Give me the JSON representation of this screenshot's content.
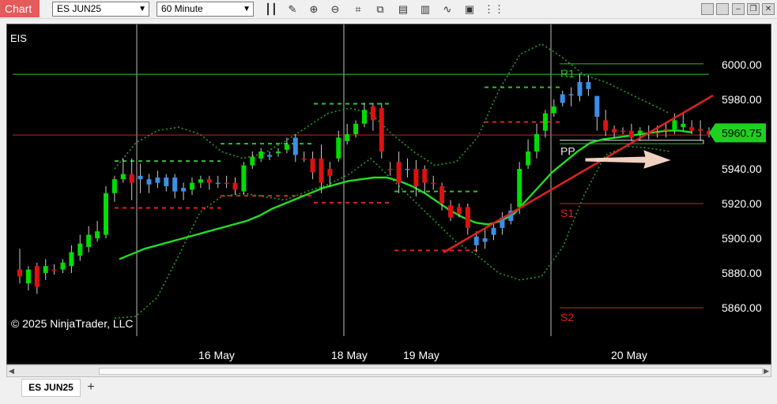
{
  "app": {
    "title": "Chart"
  },
  "toolbar": {
    "instrument": "ES JUN25",
    "interval": "60 Minute",
    "tools": [
      "bars-icon",
      "pencil-icon",
      "zoom-in-icon",
      "zoom-out-icon",
      "crosshair-icon",
      "data-box-icon",
      "instrument-icon",
      "indicators-icon",
      "strategies-icon",
      "properties-icon",
      "grid-icon"
    ]
  },
  "window_controls": [
    "minimize-icon",
    "restore-icon",
    "maximize-icon",
    "close-icon"
  ],
  "chart": {
    "instrument_label": "EIS",
    "copyright": "© 2025 NinjaTrader, LLC",
    "last_price_label": "5960.75",
    "pivot_labels": {
      "r1": "R1",
      "pp": "PP",
      "s1": "S1",
      "s2": "S2"
    },
    "colors": {
      "up": "#00dd00",
      "down": "#dd1111",
      "blue_candle": "#3a8fe8",
      "bollinger": "#2a9a2a",
      "sma": "#22dd22",
      "trendline": "#dd2222",
      "arrow": "#f0d0c0"
    }
  },
  "chart_data": {
    "type": "candlestick",
    "ylim": [
      5840,
      6010
    ],
    "y_ticks": [
      "6000.00",
      "5980.00",
      "5960.00",
      "5940.00",
      "5920.00",
      "5900.00",
      "5880.00",
      "5860.00"
    ],
    "x_labels": [
      "16 May",
      "18 May",
      "19 May",
      "20 May"
    ],
    "last_price": 5960.75,
    "candles": [
      [
        5882,
        5878,
        5894,
        5874,
        "r"
      ],
      [
        5874,
        5882,
        5884,
        5870,
        "g"
      ],
      [
        5884,
        5872,
        5886,
        5868,
        "r"
      ],
      [
        5880,
        5884,
        5888,
        5876,
        "g"
      ],
      [
        5882,
        5882,
        5885,
        5879,
        "r"
      ],
      [
        5882,
        5886,
        5888,
        5880,
        "g"
      ],
      [
        5884,
        5892,
        5896,
        5880,
        "g"
      ],
      [
        5890,
        5897,
        5902,
        5887,
        "g"
      ],
      [
        5895,
        5902,
        5907,
        5892,
        "g"
      ],
      [
        5900,
        5904,
        5910,
        5898,
        "g"
      ],
      [
        5902,
        5926,
        5930,
        5900,
        "g"
      ],
      [
        5926,
        5934,
        5936,
        5921,
        "g"
      ],
      [
        5934,
        5937,
        5946,
        5932,
        "g"
      ],
      [
        5937,
        5932,
        5946,
        5922,
        "r"
      ],
      [
        5936,
        5934,
        5943,
        5926,
        "b"
      ],
      [
        5934,
        5931,
        5937,
        5926,
        "b"
      ],
      [
        5935,
        5932,
        5939,
        5929,
        "b"
      ],
      [
        5935,
        5930,
        5937,
        5927,
        "b"
      ],
      [
        5935,
        5927,
        5937,
        5923,
        "b"
      ],
      [
        5929,
        5927,
        5932,
        5922,
        "b"
      ],
      [
        5928,
        5932,
        5935,
        5925,
        "g"
      ],
      [
        5932,
        5934,
        5936,
        5929,
        "g"
      ],
      [
        5934,
        5932,
        5936,
        5928,
        "r"
      ],
      [
        5932,
        5932,
        5936,
        5929,
        "b"
      ],
      [
        5932,
        5932,
        5936,
        5929,
        "r"
      ],
      [
        5932,
        5928,
        5935,
        5925,
        "r"
      ],
      [
        5927,
        5942,
        5944,
        5925,
        "g"
      ],
      [
        5942,
        5947,
        5950,
        5940,
        "g"
      ],
      [
        5946,
        5950,
        5952,
        5944,
        "g"
      ],
      [
        5947,
        5948,
        5950,
        5945,
        "b"
      ],
      [
        5949,
        5950,
        5952,
        5947,
        "g"
      ],
      [
        5951,
        5954,
        5958,
        5949,
        "g"
      ],
      [
        5958,
        5948,
        5960,
        5944,
        "b"
      ],
      [
        5946,
        5946,
        5950,
        5944,
        "r"
      ],
      [
        5946,
        5938,
        5950,
        5934,
        "r"
      ],
      [
        5946,
        5932,
        5954,
        5926,
        "r"
      ],
      [
        5936,
        5940,
        5944,
        5930,
        "r"
      ],
      [
        5946,
        5958,
        5962,
        5944,
        "g"
      ],
      [
        5956,
        5960,
        5966,
        5954,
        "g"
      ],
      [
        5960,
        5966,
        5968,
        5958,
        "g"
      ],
      [
        5966,
        5974,
        5978,
        5964,
        "g"
      ],
      [
        5976,
        5968,
        5978,
        5962,
        "r"
      ],
      [
        5975,
        5950,
        5978,
        5946,
        "r"
      ],
      [
        5940,
        5940,
        5944,
        5936,
        "r"
      ],
      [
        5944,
        5932,
        5950,
        5926,
        "r"
      ],
      [
        5940,
        5940,
        5946,
        5935,
        "b"
      ],
      [
        5940,
        5930,
        5945,
        5924,
        "r"
      ],
      [
        5932,
        5940,
        5942,
        5926,
        "r"
      ],
      [
        5932,
        5932,
        5936,
        5928,
        "r"
      ],
      [
        5930,
        5920,
        5932,
        5916,
        "r"
      ],
      [
        5919,
        5912,
        5922,
        5910,
        "r"
      ],
      [
        5918,
        5914,
        5920,
        5912,
        "r"
      ],
      [
        5918,
        5906,
        5920,
        5902,
        "r"
      ],
      [
        5901,
        5896,
        5904,
        5892,
        "b"
      ],
      [
        5898,
        5900,
        5906,
        5894,
        "b"
      ],
      [
        5902,
        5906,
        5908,
        5899,
        "b"
      ],
      [
        5906,
        5912,
        5915,
        5902,
        "b"
      ],
      [
        5910,
        5916,
        5920,
        5908,
        "b"
      ],
      [
        5918,
        5940,
        5944,
        5914,
        "g"
      ],
      [
        5942,
        5950,
        5957,
        5940,
        "g"
      ],
      [
        5950,
        5960,
        5966,
        5946,
        "g"
      ],
      [
        5962,
        5972,
        5974,
        5958,
        "g"
      ],
      [
        5972,
        5976,
        5980,
        5970,
        "g"
      ],
      [
        5978,
        5983,
        5985,
        5976,
        "b"
      ],
      [
        5983,
        5983,
        5987,
        5976,
        "b"
      ],
      [
        5990,
        5982,
        5995,
        5979,
        "b"
      ],
      [
        5986,
        5990,
        5994,
        5982,
        "b"
      ],
      [
        5982,
        5970,
        5982,
        5962,
        "b"
      ],
      [
        5968,
        5962,
        5974,
        5959,
        "r"
      ],
      [
        5963,
        5961,
        5965,
        5958,
        "r"
      ],
      [
        5962,
        5962,
        5964,
        5960,
        "r"
      ],
      [
        5962,
        5958,
        5966,
        5956,
        "r"
      ],
      [
        5960,
        5962,
        5964,
        5956,
        "g"
      ],
      [
        5960,
        5961,
        5965,
        5957,
        "r"
      ],
      [
        5961,
        5961,
        5965,
        5958,
        "r"
      ],
      [
        5962,
        5963,
        5966,
        5958,
        "r"
      ],
      [
        5962,
        5968,
        5972,
        5960,
        "g"
      ],
      [
        5964,
        5966,
        5972,
        5962,
        "g"
      ],
      [
        5964,
        5962,
        5968,
        5960,
        "r"
      ],
      [
        5963,
        5962,
        5968,
        5956,
        "r"
      ],
      [
        5962,
        5960,
        5964,
        5958,
        "r"
      ]
    ],
    "sma": [
      5888,
      5891,
      5894,
      5896,
      5898,
      5900,
      5902,
      5904,
      5906,
      5908,
      5910,
      5913,
      5917,
      5920,
      5923,
      5926,
      5929,
      5931,
      5933,
      5934,
      5935,
      5935,
      5933,
      5930,
      5926,
      5921,
      5916,
      5912,
      5909,
      5908,
      5910,
      5914,
      5922,
      5930,
      5938,
      5944,
      5950,
      5955,
      5957,
      5958,
      5959,
      5960,
      5961,
      5962,
      5962,
      5961
    ],
    "bollinger_upper": [
      5940,
      5955,
      5962,
      5964,
      5960,
      5950,
      5946,
      5949,
      5956,
      5964,
      5972,
      5975,
      5972,
      5960,
      5950,
      5942,
      5944,
      5958,
      5985,
      6006,
      6012,
      6004,
      5994,
      5990,
      5984,
      5978,
      5972
    ],
    "bollinger_lower": [
      5854,
      5855,
      5866,
      5890,
      5915,
      5924,
      5926,
      5924,
      5922,
      5927,
      5931,
      5937,
      5946,
      5934,
      5922,
      5910,
      5898,
      5890,
      5880,
      5876,
      5878,
      5895,
      5925,
      5948,
      5953,
      5952,
      5950
    ],
    "pivot_levels": {
      "r1": 6000.5,
      "pp": 5956.5,
      "s1": 5920.0,
      "s2": 5860.0
    },
    "horizontal_lines": [
      5994.5,
      5959.5
    ]
  }
}
